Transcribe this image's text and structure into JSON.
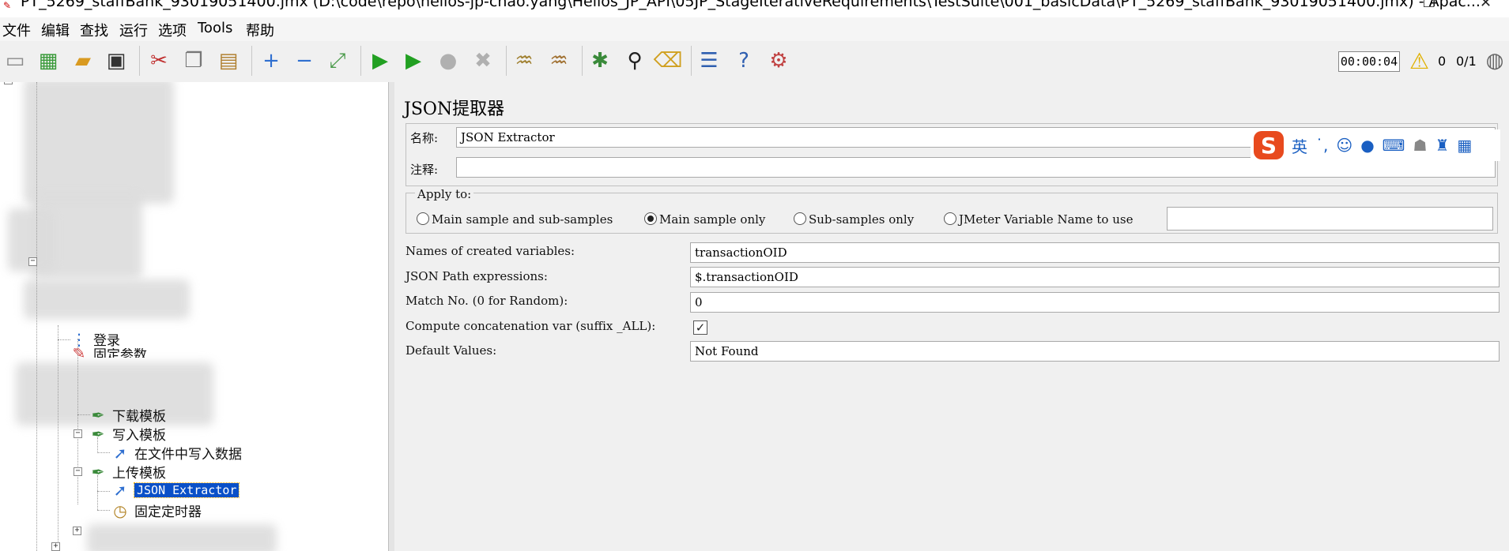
{
  "window": {
    "title": "PT_5269_staffBank_93019051400.jmx (D:\\code\\repo\\helios-jp-chao.yang\\Helios_JP_API\\05JP_StageIterativeRequirements\\TestSuite\\001_basicData\\PT_5269_staffBank_93019051400.jmx) - Apac...",
    "restore_glyph": "❐",
    "close_glyph": "✕"
  },
  "menu": [
    "文件",
    "编辑",
    "查找",
    "运行",
    "选项",
    "Tools",
    "帮助"
  ],
  "toolbar": {
    "timer": "00:00:04",
    "warning_count": "0",
    "threads": "0/1"
  },
  "tree": {
    "nodes": [
      {
        "label": "登录",
        "icon": "sampler-icon"
      },
      {
        "label": "固定参数",
        "icon": "config-icon"
      },
      {
        "label": "下载模板",
        "icon": "http-sampler-icon"
      },
      {
        "label": "写入模板",
        "icon": "http-sampler-icon"
      },
      {
        "label": "在文件中写入数据",
        "icon": "postprocessor-icon"
      },
      {
        "label": "上传模板",
        "icon": "http-sampler-icon"
      },
      {
        "label": "JSON Extractor",
        "icon": "postprocessor-icon"
      },
      {
        "label": "固定定时器",
        "icon": "timer-icon"
      }
    ]
  },
  "panel": {
    "title": "JSON提取器",
    "name_label": "名称:",
    "name_value": "JSON Extractor",
    "comment_label": "注释:",
    "comment_value": "",
    "apply_to": {
      "legend": "Apply to:",
      "options": [
        "Main sample and sub-samples",
        "Main sample only",
        "Sub-samples only",
        "JMeter Variable Name to use"
      ],
      "selected": "Main sample only",
      "variable_value": ""
    },
    "fields": {
      "names_label": "Names of created variables:",
      "names_value": "transactionOID",
      "path_label": "JSON Path expressions:",
      "path_value": "$.transactionOID",
      "match_label": "Match No. (0 for Random):",
      "match_value": "0",
      "concat_label": "Compute concatenation var (suffix _ALL):",
      "concat_checked": true,
      "default_label": "Default Values:",
      "default_value": "Not Found"
    }
  },
  "ime": {
    "logo": "S",
    "lang": "英"
  }
}
